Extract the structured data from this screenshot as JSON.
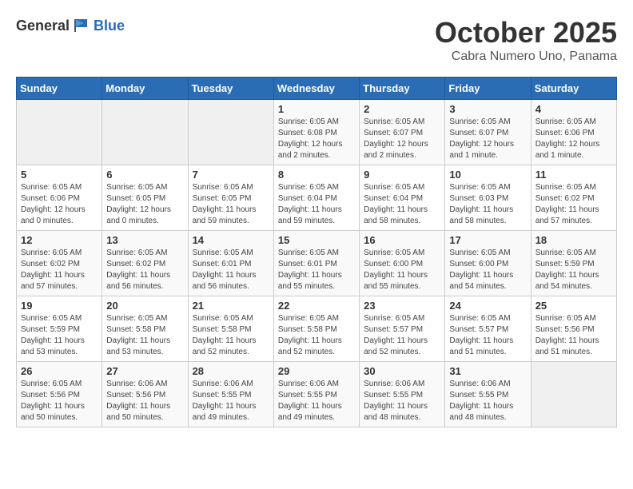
{
  "logo": {
    "general": "General",
    "blue": "Blue"
  },
  "header": {
    "month": "October 2025",
    "location": "Cabra Numero Uno, Panama"
  },
  "weekdays": [
    "Sunday",
    "Monday",
    "Tuesday",
    "Wednesday",
    "Thursday",
    "Friday",
    "Saturday"
  ],
  "weeks": [
    [
      {
        "day": null,
        "info": null
      },
      {
        "day": null,
        "info": null
      },
      {
        "day": null,
        "info": null
      },
      {
        "day": "1",
        "info": "Sunrise: 6:05 AM\nSunset: 6:08 PM\nDaylight: 12 hours\nand 2 minutes."
      },
      {
        "day": "2",
        "info": "Sunrise: 6:05 AM\nSunset: 6:07 PM\nDaylight: 12 hours\nand 2 minutes."
      },
      {
        "day": "3",
        "info": "Sunrise: 6:05 AM\nSunset: 6:07 PM\nDaylight: 12 hours\nand 1 minute."
      },
      {
        "day": "4",
        "info": "Sunrise: 6:05 AM\nSunset: 6:06 PM\nDaylight: 12 hours\nand 1 minute."
      }
    ],
    [
      {
        "day": "5",
        "info": "Sunrise: 6:05 AM\nSunset: 6:06 PM\nDaylight: 12 hours\nand 0 minutes."
      },
      {
        "day": "6",
        "info": "Sunrise: 6:05 AM\nSunset: 6:05 PM\nDaylight: 12 hours\nand 0 minutes."
      },
      {
        "day": "7",
        "info": "Sunrise: 6:05 AM\nSunset: 6:05 PM\nDaylight: 11 hours\nand 59 minutes."
      },
      {
        "day": "8",
        "info": "Sunrise: 6:05 AM\nSunset: 6:04 PM\nDaylight: 11 hours\nand 59 minutes."
      },
      {
        "day": "9",
        "info": "Sunrise: 6:05 AM\nSunset: 6:04 PM\nDaylight: 11 hours\nand 58 minutes."
      },
      {
        "day": "10",
        "info": "Sunrise: 6:05 AM\nSunset: 6:03 PM\nDaylight: 11 hours\nand 58 minutes."
      },
      {
        "day": "11",
        "info": "Sunrise: 6:05 AM\nSunset: 6:02 PM\nDaylight: 11 hours\nand 57 minutes."
      }
    ],
    [
      {
        "day": "12",
        "info": "Sunrise: 6:05 AM\nSunset: 6:02 PM\nDaylight: 11 hours\nand 57 minutes."
      },
      {
        "day": "13",
        "info": "Sunrise: 6:05 AM\nSunset: 6:02 PM\nDaylight: 11 hours\nand 56 minutes."
      },
      {
        "day": "14",
        "info": "Sunrise: 6:05 AM\nSunset: 6:01 PM\nDaylight: 11 hours\nand 56 minutes."
      },
      {
        "day": "15",
        "info": "Sunrise: 6:05 AM\nSunset: 6:01 PM\nDaylight: 11 hours\nand 55 minutes."
      },
      {
        "day": "16",
        "info": "Sunrise: 6:05 AM\nSunset: 6:00 PM\nDaylight: 11 hours\nand 55 minutes."
      },
      {
        "day": "17",
        "info": "Sunrise: 6:05 AM\nSunset: 6:00 PM\nDaylight: 11 hours\nand 54 minutes."
      },
      {
        "day": "18",
        "info": "Sunrise: 6:05 AM\nSunset: 5:59 PM\nDaylight: 11 hours\nand 54 minutes."
      }
    ],
    [
      {
        "day": "19",
        "info": "Sunrise: 6:05 AM\nSunset: 5:59 PM\nDaylight: 11 hours\nand 53 minutes."
      },
      {
        "day": "20",
        "info": "Sunrise: 6:05 AM\nSunset: 5:58 PM\nDaylight: 11 hours\nand 53 minutes."
      },
      {
        "day": "21",
        "info": "Sunrise: 6:05 AM\nSunset: 5:58 PM\nDaylight: 11 hours\nand 52 minutes."
      },
      {
        "day": "22",
        "info": "Sunrise: 6:05 AM\nSunset: 5:58 PM\nDaylight: 11 hours\nand 52 minutes."
      },
      {
        "day": "23",
        "info": "Sunrise: 6:05 AM\nSunset: 5:57 PM\nDaylight: 11 hours\nand 52 minutes."
      },
      {
        "day": "24",
        "info": "Sunrise: 6:05 AM\nSunset: 5:57 PM\nDaylight: 11 hours\nand 51 minutes."
      },
      {
        "day": "25",
        "info": "Sunrise: 6:05 AM\nSunset: 5:56 PM\nDaylight: 11 hours\nand 51 minutes."
      }
    ],
    [
      {
        "day": "26",
        "info": "Sunrise: 6:05 AM\nSunset: 5:56 PM\nDaylight: 11 hours\nand 50 minutes."
      },
      {
        "day": "27",
        "info": "Sunrise: 6:06 AM\nSunset: 5:56 PM\nDaylight: 11 hours\nand 50 minutes."
      },
      {
        "day": "28",
        "info": "Sunrise: 6:06 AM\nSunset: 5:55 PM\nDaylight: 11 hours\nand 49 minutes."
      },
      {
        "day": "29",
        "info": "Sunrise: 6:06 AM\nSunset: 5:55 PM\nDaylight: 11 hours\nand 49 minutes."
      },
      {
        "day": "30",
        "info": "Sunrise: 6:06 AM\nSunset: 5:55 PM\nDaylight: 11 hours\nand 48 minutes."
      },
      {
        "day": "31",
        "info": "Sunrise: 6:06 AM\nSunset: 5:55 PM\nDaylight: 11 hours\nand 48 minutes."
      },
      {
        "day": null,
        "info": null
      }
    ]
  ]
}
